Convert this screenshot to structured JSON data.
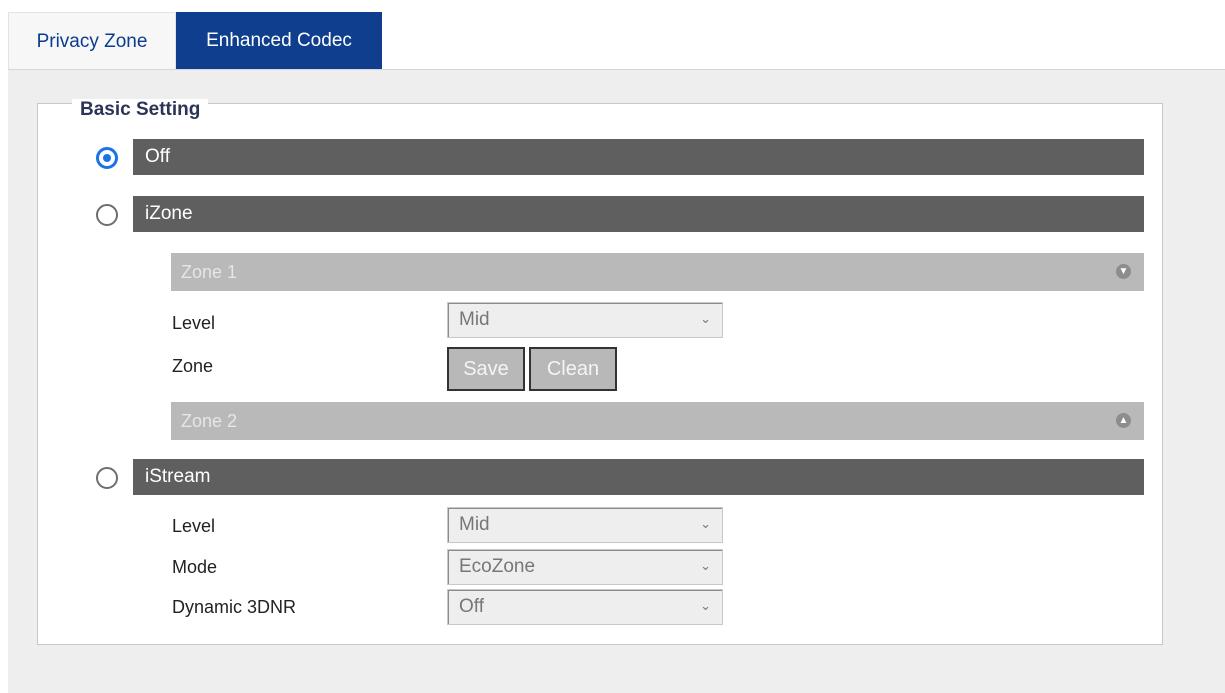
{
  "tabs": [
    {
      "label": "Privacy Zone",
      "active": false
    },
    {
      "label": "Enhanced Codec",
      "active": true
    }
  ],
  "fieldset": {
    "legend": "Basic Setting"
  },
  "options": {
    "off": {
      "label": "Off",
      "selected": true
    },
    "izone": {
      "label": "iZone",
      "selected": false
    },
    "istream": {
      "label": "iStream",
      "selected": false
    }
  },
  "izone": {
    "zone1": {
      "label": "Zone 1",
      "icon": "circle-arrow-down-icon"
    },
    "zone2": {
      "label": "Zone 2",
      "icon": "circle-arrow-up-icon"
    },
    "level_label": "Level",
    "level_value": "Mid",
    "zone_label": "Zone",
    "save_label": "Save",
    "clean_label": "Clean"
  },
  "istream": {
    "level_label": "Level",
    "level_value": "Mid",
    "mode_label": "Mode",
    "mode_value": "EcoZone",
    "dnr_label": "Dynamic 3DNR",
    "dnr_value": "Off"
  },
  "colors": {
    "active_tab": "#0f3e8f",
    "inactive_tab_text": "#0a3d91",
    "option_bar": "#5f5f5f",
    "zone_bar": "#b9b9b9",
    "radio_selected": "#1a73e8",
    "legend_text": "#2e3457"
  }
}
